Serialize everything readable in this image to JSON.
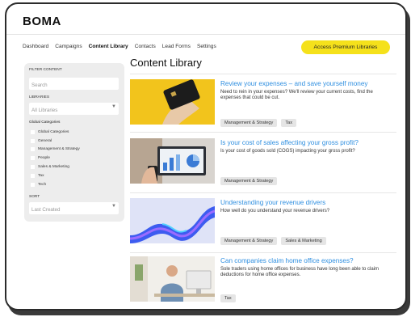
{
  "app": {
    "logo": "BOMA"
  },
  "nav": {
    "items": [
      {
        "label": "Dashboard",
        "active": false
      },
      {
        "label": "Campaigns",
        "active": false
      },
      {
        "label": "Content Library",
        "active": true
      },
      {
        "label": "Contacts",
        "active": false
      },
      {
        "label": "Lead Forms",
        "active": false
      },
      {
        "label": "Settings",
        "active": false
      }
    ],
    "premium_label": "Access Premium Libraries"
  },
  "sidebar": {
    "filter_label": "FILTER CONTENT",
    "search_placeholder": "Search",
    "libraries_label": "LIBRARIES",
    "libraries_value": "All Libraries",
    "global_categories_label": "Global Categories",
    "categories": [
      "Global Categories",
      "General",
      "Management & Strategy",
      "People",
      "Sales & Marketing",
      "Tax",
      "Tech"
    ],
    "sort_label": "SORT",
    "sort_value": "Last Created"
  },
  "main": {
    "heading": "Content Library",
    "cards": [
      {
        "title": "Review your expenses – and save yourself money",
        "description": "Need to rein in your expenses? We'll review your current costs, find the expenses that could be cut.",
        "tags": [
          "Management & Strategy",
          "Tax"
        ]
      },
      {
        "title": "Is your cost of sales affecting your gross profit?",
        "description": "Is your cost of goods sold (COGS) impacting your gross profit?",
        "tags": [
          "Management & Strategy"
        ]
      },
      {
        "title": "Understanding your revenue drivers",
        "description": "How well do you understand your revenue drivers?",
        "tags": [
          "Management & Strategy",
          "Sales & Marketing"
        ]
      },
      {
        "title": "Can companies claim home office expenses?",
        "description": "Sole traders using home offices for business have long been able to claim deductions for home office expenses.",
        "tags": [
          "Tax"
        ]
      }
    ]
  },
  "colors": {
    "accent_yellow": "#f5e11b",
    "link_blue": "#2f8fe0",
    "sidebar_bg": "#ededed"
  }
}
